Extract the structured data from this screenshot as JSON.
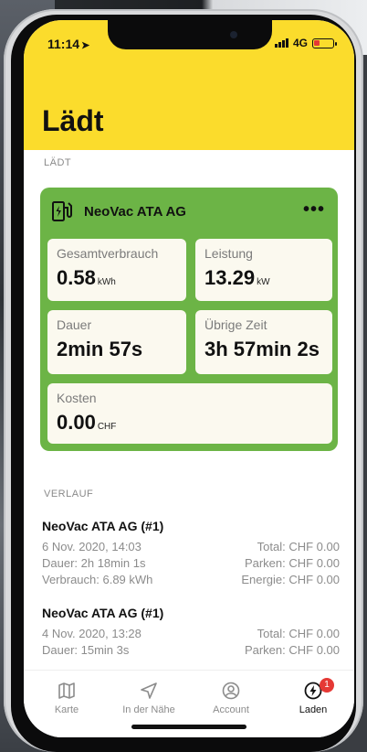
{
  "status_bar": {
    "time": "11:14",
    "network": "4G"
  },
  "page": {
    "title": "Lädt"
  },
  "current": {
    "section_label": "LÄDT",
    "station": "NeoVac ATA AG",
    "metrics": {
      "consumption": {
        "label": "Gesamtverbrauch",
        "value": "0.58",
        "unit": "kWh"
      },
      "power": {
        "label": "Leistung",
        "value": "13.29",
        "unit": "kW"
      },
      "duration": {
        "label": "Dauer",
        "value": "2min 57s"
      },
      "remaining": {
        "label": "Übrige Zeit",
        "value": "3h 57min 2s"
      },
      "cost": {
        "label": "Kosten",
        "value": "0.00",
        "unit": "CHF"
      }
    }
  },
  "history": {
    "section_label": "VERLAUF",
    "items": [
      {
        "name": "NeoVac ATA AG (#1)",
        "date": "6 Nov. 2020, 14:03",
        "duration": "Dauer: 2h 18min 1s",
        "consumption": "Verbrauch: 6.89 kWh",
        "total": "Total: CHF 0.00",
        "parking": "Parken: CHF 0.00",
        "energy": "Energie: CHF 0.00"
      },
      {
        "name": "NeoVac ATA AG (#1)",
        "date": "4 Nov. 2020, 13:28",
        "duration": "Dauer: 15min 3s",
        "total": "Total: CHF 0.00",
        "parking": "Parken: CHF 0.00"
      }
    ]
  },
  "tabs": [
    {
      "label": "Karte",
      "icon": "map-icon"
    },
    {
      "label": "In der Nähe",
      "icon": "navigation-arrow-icon"
    },
    {
      "label": "Account",
      "icon": "account-icon"
    },
    {
      "label": "Laden",
      "icon": "charging-icon",
      "badge": "1",
      "active": true
    }
  ],
  "colors": {
    "header": "#fbdc2c",
    "card": "#6cb446",
    "badge": "#e53935"
  }
}
